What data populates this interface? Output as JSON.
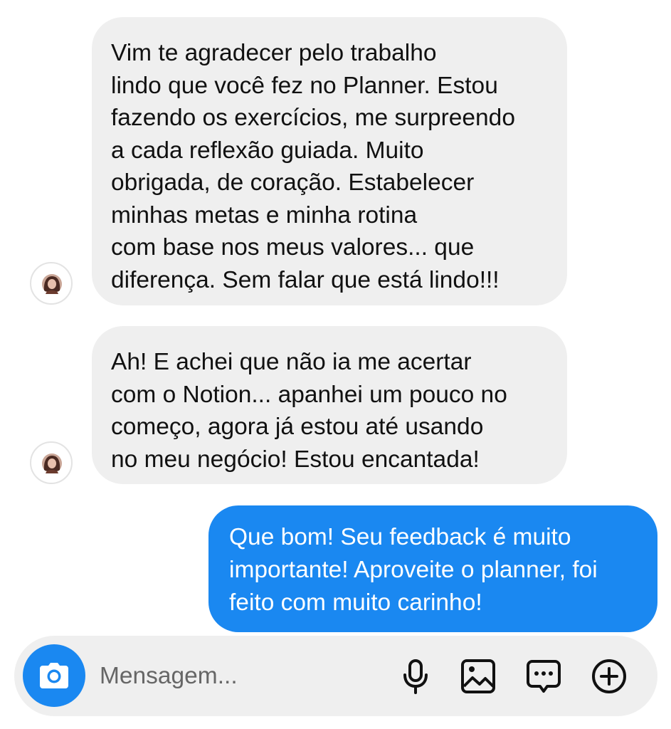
{
  "conversation": {
    "messages": [
      {
        "sender": "contact",
        "lines": [
          "Vim te agradecer pelo trabalho",
          "lindo que você fez no Planner. Estou",
          "fazendo os exercícios, me surpreendo",
          "a cada reflexão guiada. Muito",
          "obrigada,  de coração. Estabelecer",
          "minhas metas e minha rotina",
          "com base nos meus valores... que",
          "diferença. Sem falar que está lindo!!!"
        ]
      },
      {
        "sender": "contact",
        "lines": [
          "Ah! E achei que não ia me acertar",
          "com o Notion... apanhei um pouco no",
          "começo, agora já estou até usando",
          "no meu negócio! Estou encantada!"
        ]
      },
      {
        "sender": "me",
        "lines": [
          "Que bom! Seu feedback é muito",
          "importante! Aproveite o planner, foi",
          "feito com muito carinho!"
        ]
      }
    ]
  },
  "composer": {
    "placeholder": "Mensagem...",
    "icons": [
      "camera-icon",
      "microphone-icon",
      "gallery-icon",
      "sticker-icon",
      "plus-icon"
    ]
  },
  "colors": {
    "incoming_bubble": "#efefef",
    "outgoing_bubble": "#1a88f1",
    "composer_bg": "#efefef"
  }
}
